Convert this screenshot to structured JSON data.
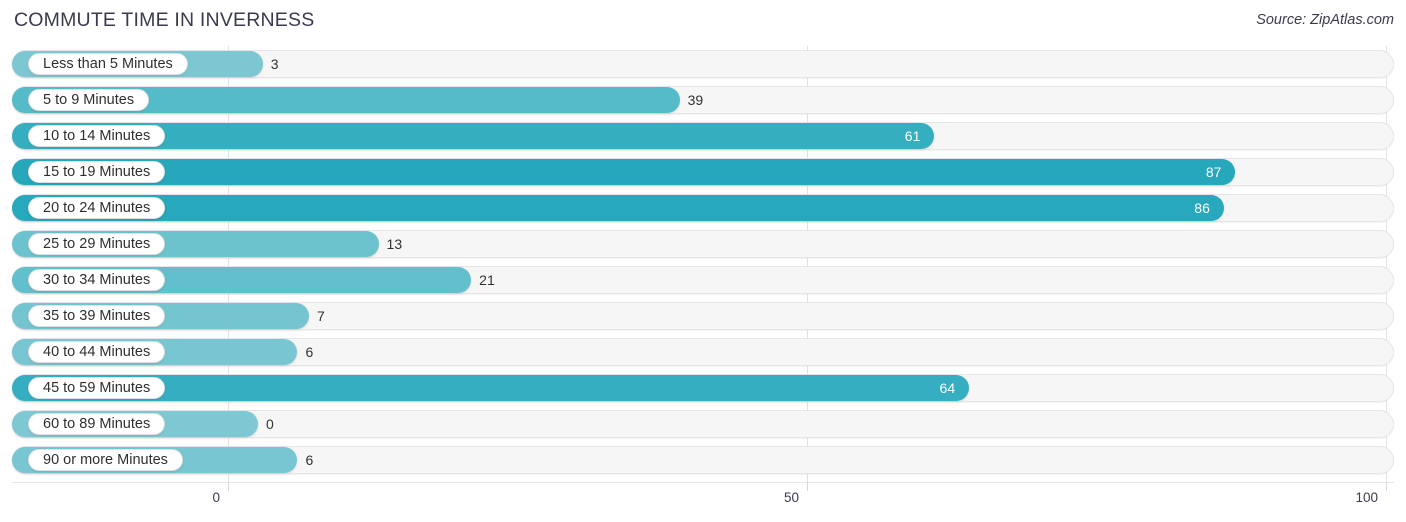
{
  "header": {
    "title": "COMMUTE TIME IN INVERNESS",
    "source": "Source: ZipAtlas.com"
  },
  "axis": {
    "ticks": [
      {
        "label": "0",
        "value": 0
      },
      {
        "label": "50",
        "value": 50
      },
      {
        "label": "100",
        "value": 100
      }
    ]
  },
  "chart_data": {
    "type": "bar",
    "orientation": "horizontal",
    "title": "COMMUTE TIME IN INVERNESS",
    "xlabel": "",
    "ylabel": "",
    "xlim": [
      0,
      100
    ],
    "grid": true,
    "legend": false,
    "source": "Source: ZipAtlas.com",
    "categories": [
      "Less than 5 Minutes",
      "5 to 9 Minutes",
      "10 to 14 Minutes",
      "15 to 19 Minutes",
      "20 to 24 Minutes",
      "25 to 29 Minutes",
      "30 to 34 Minutes",
      "35 to 39 Minutes",
      "40 to 44 Minutes",
      "45 to 59 Minutes",
      "60 to 89 Minutes",
      "90 or more Minutes"
    ],
    "values": [
      3,
      39,
      61,
      87,
      86,
      13,
      21,
      7,
      6,
      64,
      0,
      6
    ],
    "value_labels": [
      "3",
      "39",
      "61",
      "87",
      "86",
      "13",
      "21",
      "7",
      "6",
      "64",
      "0",
      "6"
    ],
    "bar_colors": [
      "#7cc7d2",
      "#54bcc9",
      "#35afc0",
      "#26a7bb",
      "#27a8bc",
      "#6cc3ce",
      "#62c0cc",
      "#74c5d0",
      "#78c6d1",
      "#34aec0",
      "#7ec8d3",
      "#78c6d1"
    ],
    "label_inside": [
      false,
      false,
      true,
      true,
      true,
      false,
      false,
      false,
      false,
      true,
      false,
      false
    ]
  },
  "colors": {
    "accent_light": "#7cc7d2",
    "accent_dark": "#26a7bb",
    "track": "#f6f6f6",
    "track_border": "#e6e6e6",
    "text": "#3b3b4f",
    "gridline": "#e3e3e3"
  }
}
